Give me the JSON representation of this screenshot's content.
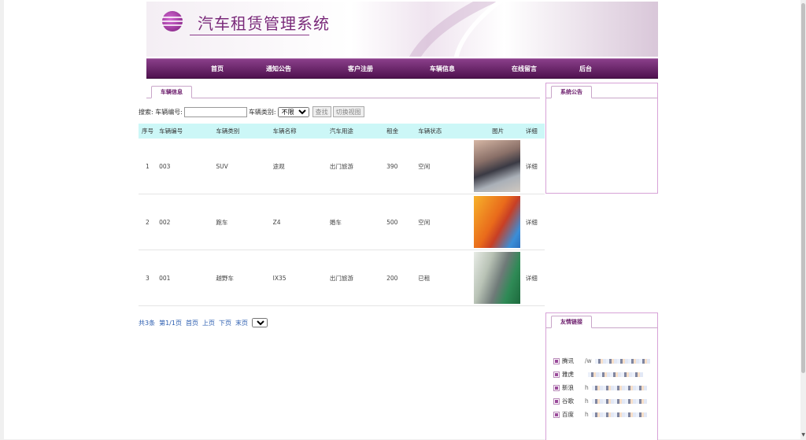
{
  "header": {
    "site_title": "汽车租赁管理系统"
  },
  "nav": [
    {
      "label": "首页"
    },
    {
      "label": "通知公告"
    },
    {
      "label": "客户注册"
    },
    {
      "label": "车辆信息"
    },
    {
      "label": "在线留言"
    },
    {
      "label": "后台"
    }
  ],
  "main": {
    "tab_label": "车辆信息",
    "search": {
      "label_id": "搜索: 车辆编号:",
      "id_value": "",
      "label_type": "车辆类别:",
      "type_selected": "不限",
      "search_button": "查找",
      "view_button": "切换视图"
    },
    "table": {
      "headers": [
        "序号",
        "车辆编号",
        "车辆类别",
        "车辆名称",
        "汽车用途",
        "租金",
        "车辆状态",
        "图片",
        "详细"
      ],
      "rows": [
        {
          "no": "1",
          "id": "003",
          "type": "SUV",
          "name": "途观",
          "use": "出门旅游",
          "rent": "390",
          "status": "空闲",
          "detail": "详细"
        },
        {
          "no": "2",
          "id": "002",
          "type": "跑车",
          "name": "Z4",
          "use": "婚车",
          "rent": "500",
          "status": "空闲",
          "detail": "详细"
        },
        {
          "no": "3",
          "id": "001",
          "type": "越野车",
          "name": "IX35",
          "use": "出门旅游",
          "rent": "200",
          "status": "已租",
          "detail": "详细"
        }
      ]
    },
    "pager": {
      "total": "共3条",
      "page_info": "第1/1页",
      "first": "首页",
      "prev": "上页",
      "next": "下页",
      "last": "末页",
      "page_selected": "1"
    }
  },
  "sidebar": {
    "notice_title": "系统公告",
    "links_title": "友情链接",
    "links": [
      {
        "name": "腾讯",
        "url_visible": "/w"
      },
      {
        "name": "雅虎",
        "url_visible": ""
      },
      {
        "name": "新浪",
        "url_visible": "h"
      },
      {
        "name": "谷歌",
        "url_visible": "h"
      },
      {
        "name": "百度",
        "url_visible": "h"
      }
    ]
  },
  "colors": {
    "brand_purple": "#6a1a6a",
    "table_header_bg": "#ccf7f7",
    "link_blue": "#2b5db0"
  }
}
